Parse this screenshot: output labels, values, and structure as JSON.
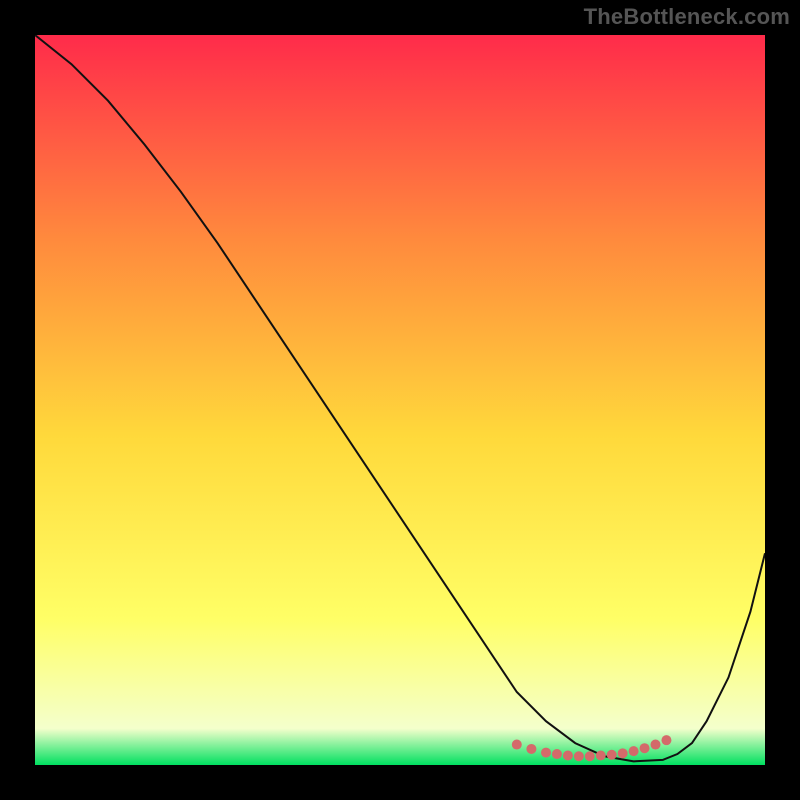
{
  "watermark": "TheBottleneck.com",
  "chart_data": {
    "type": "line",
    "title": "",
    "xlabel": "",
    "ylabel": "",
    "xlim": [
      0,
      100
    ],
    "ylim": [
      0,
      100
    ],
    "grid": false,
    "legend": false,
    "background_gradient": {
      "top_color": "#ff2b4a",
      "mid_upper_color": "#ff8a3d",
      "mid_color": "#ffd93b",
      "lower_color": "#ffff66",
      "near_bottom_color": "#f4ffcc",
      "bottom_color": "#00e060"
    },
    "series": [
      {
        "name": "bottleneck-curve",
        "color": "#111111",
        "stroke_width": 2,
        "x": [
          0,
          5,
          10,
          15,
          20,
          25,
          30,
          35,
          40,
          45,
          50,
          55,
          60,
          63,
          66,
          70,
          74,
          78,
          82,
          86,
          88,
          90,
          92,
          95,
          98,
          100
        ],
        "y": [
          100,
          96,
          91,
          85,
          78.5,
          71.5,
          64,
          56.5,
          49,
          41.5,
          34,
          26.5,
          19,
          14.5,
          10,
          6,
          3,
          1.2,
          0.5,
          0.7,
          1.5,
          3,
          6,
          12,
          21,
          29
        ]
      }
    ],
    "optimal_band": {
      "name": "optimal-points",
      "marker_color": "#d46a6a",
      "marker_radius": 5,
      "x": [
        66,
        68,
        70,
        71.5,
        73,
        74.5,
        76,
        77.5,
        79,
        80.5,
        82,
        83.5,
        85,
        86.5
      ],
      "y": [
        2.8,
        2.2,
        1.7,
        1.5,
        1.3,
        1.2,
        1.2,
        1.3,
        1.4,
        1.6,
        1.9,
        2.3,
        2.8,
        3.4
      ]
    }
  }
}
